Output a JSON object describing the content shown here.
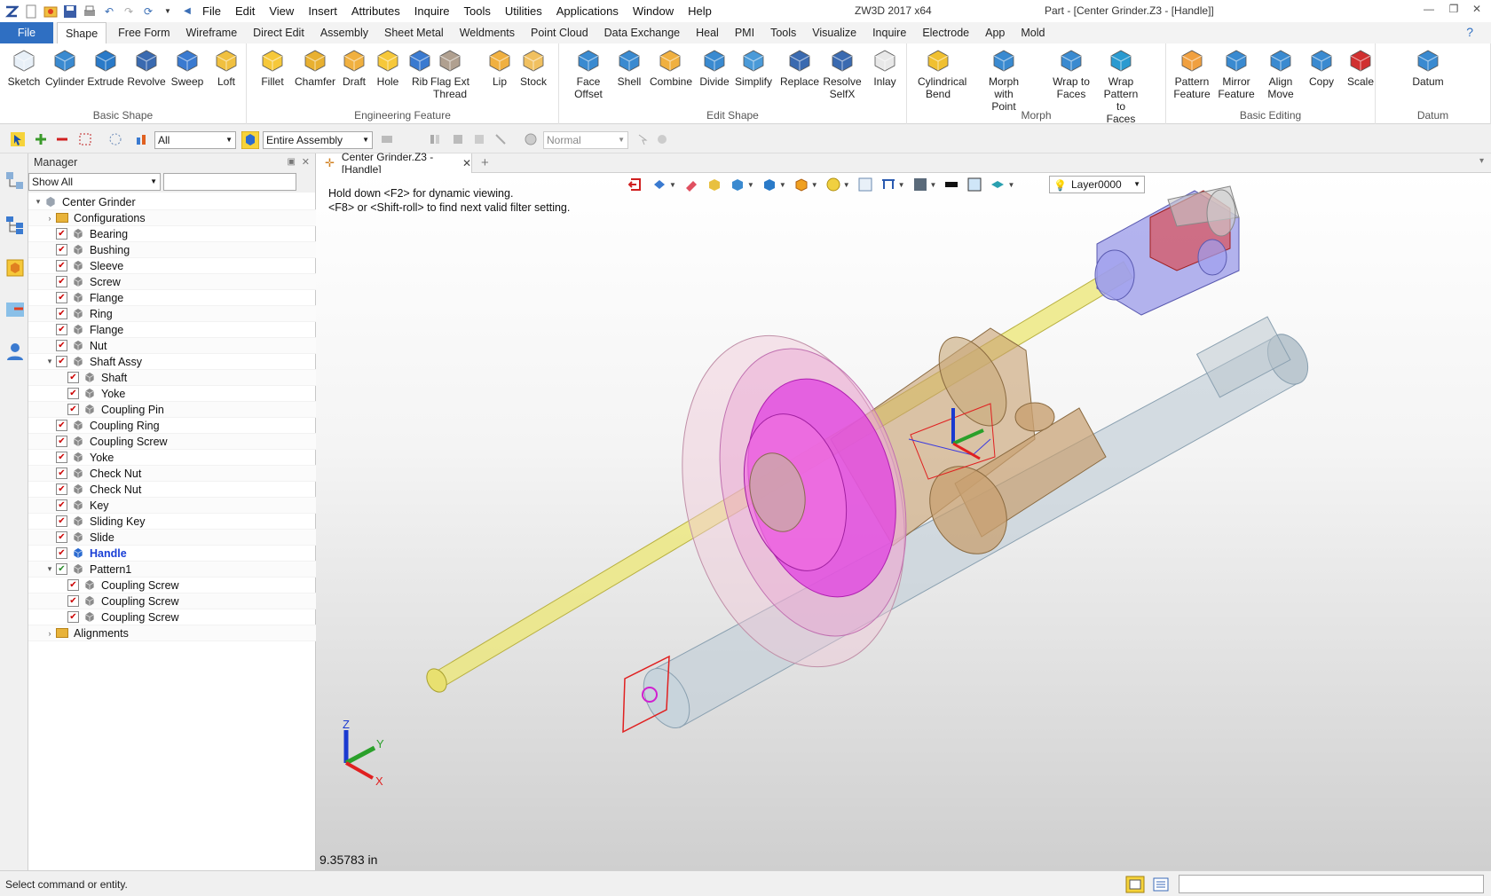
{
  "titlebar": {
    "menus": [
      "File",
      "Edit",
      "View",
      "Insert",
      "Attributes",
      "Inquire",
      "Tools",
      "Utilities",
      "Applications",
      "Window",
      "Help"
    ],
    "app_name": "ZW3D 2017  x64",
    "doc_title": "Part - [Center Grinder.Z3 - [Handle]]"
  },
  "ribbon_tabs": [
    "File",
    "Shape",
    "Free Form",
    "Wireframe",
    "Direct Edit",
    "Assembly",
    "Sheet Metal",
    "Weldments",
    "Point Cloud",
    "Data Exchange",
    "Heal",
    "PMI",
    "Tools",
    "Visualize",
    "Inquire",
    "Electrode",
    "App",
    "Mold"
  ],
  "ribbon": {
    "basic_shape": {
      "label": "Basic Shape",
      "tools": [
        "Sketch",
        "Cylinder",
        "Extrude",
        "Revolve",
        "Sweep",
        "Loft"
      ]
    },
    "engineering_feature": {
      "label": "Engineering Feature",
      "tools": [
        "Fillet",
        "Chamfer",
        "Draft",
        "Hole",
        "Rib",
        "Flag Ext Thread",
        "Lip",
        "Stock"
      ]
    },
    "edit_shape": {
      "label": "Edit Shape",
      "tools": [
        "Face Offset",
        "Shell",
        "Combine",
        "Divide",
        "Simplify",
        "Replace",
        "Resolve SelfX",
        "Inlay"
      ]
    },
    "morph": {
      "label": "Morph",
      "tools": [
        "Cylindrical Bend",
        "Morph with Point",
        "Wrap to Faces",
        "Wrap Pattern to Faces"
      ]
    },
    "basic_editing": {
      "label": "Basic Editing",
      "tools": [
        "Pattern Feature",
        "Mirror Feature",
        "Align Move",
        "Copy",
        "Scale"
      ]
    },
    "datum": {
      "label": "Datum",
      "tools": [
        "Datum"
      ]
    }
  },
  "toolbar": {
    "filter_value": "All",
    "scope_value": "Entire Assembly",
    "mode_value": "Normal"
  },
  "manager": {
    "title": "Manager",
    "show_filter": "Show All",
    "tree": [
      {
        "label": "Center Grinder",
        "level": 0,
        "expand": "v",
        "type": "root"
      },
      {
        "label": "Configurations",
        "level": 1,
        "expand": ">",
        "type": "folder"
      },
      {
        "label": "Bearing",
        "level": 1,
        "type": "part"
      },
      {
        "label": "Bushing",
        "level": 1,
        "type": "part"
      },
      {
        "label": "Sleeve",
        "level": 1,
        "type": "part"
      },
      {
        "label": "Screw",
        "level": 1,
        "type": "part"
      },
      {
        "label": "Flange",
        "level": 1,
        "type": "part"
      },
      {
        "label": "Ring",
        "level": 1,
        "type": "part"
      },
      {
        "label": "Flange",
        "level": 1,
        "type": "part"
      },
      {
        "label": "Nut",
        "level": 1,
        "type": "part"
      },
      {
        "label": "Shaft Assy",
        "level": 1,
        "expand": "v",
        "type": "asm"
      },
      {
        "label": "Shaft",
        "level": 2,
        "type": "part"
      },
      {
        "label": "Yoke",
        "level": 2,
        "type": "part"
      },
      {
        "label": "Coupling Pin",
        "level": 2,
        "type": "part"
      },
      {
        "label": "Coupling Ring",
        "level": 1,
        "type": "part"
      },
      {
        "label": "Coupling Screw",
        "level": 1,
        "type": "part"
      },
      {
        "label": "Yoke",
        "level": 1,
        "type": "part"
      },
      {
        "label": "Check Nut",
        "level": 1,
        "type": "part"
      },
      {
        "label": "Check Nut",
        "level": 1,
        "type": "part"
      },
      {
        "label": "Key",
        "level": 1,
        "type": "part"
      },
      {
        "label": "Sliding Key",
        "level": 1,
        "type": "part"
      },
      {
        "label": "Slide",
        "level": 1,
        "type": "part"
      },
      {
        "label": "Handle",
        "level": 1,
        "type": "active"
      },
      {
        "label": "Pattern1",
        "level": 1,
        "expand": "v",
        "type": "pattern"
      },
      {
        "label": "Coupling Screw",
        "level": 2,
        "type": "part"
      },
      {
        "label": "Coupling Screw",
        "level": 2,
        "type": "part"
      },
      {
        "label": "Coupling Screw",
        "level": 2,
        "type": "part"
      },
      {
        "label": "Alignments",
        "level": 1,
        "expand": ">",
        "type": "folder"
      }
    ]
  },
  "viewport": {
    "tab_label": "Center Grinder.Z3 - [Handle]",
    "hint_line1": "Hold down <F2> for dynamic viewing.",
    "hint_line2": "<F8> or <Shift-roll> to find next valid filter setting.",
    "layer": "Layer0000",
    "distance": "9.35783 in",
    "axis_x": "X",
    "axis_y": "Y",
    "axis_z": "Z"
  },
  "status": {
    "text": "Select command or entity."
  },
  "colors": {
    "accent": "#2f6fc2",
    "handle_blue": "#1a3fd6",
    "shaft_yellow": "#e8e070",
    "wheel_magenta": "#e040e0",
    "bronze": "#c8a070"
  }
}
